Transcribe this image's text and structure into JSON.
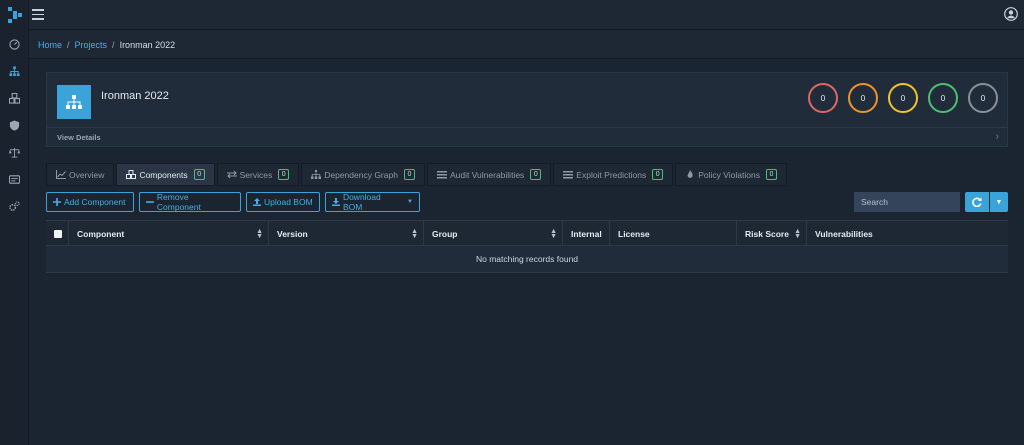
{
  "breadcrumb": {
    "home": "Home",
    "projects": "Projects",
    "current": "Ironman 2022"
  },
  "project": {
    "name": "Ironman 2022",
    "view_details": "View Details",
    "severity_counts": [
      {
        "value": "0",
        "color": "#e06666"
      },
      {
        "value": "0",
        "color": "#f0922b"
      },
      {
        "value": "0",
        "color": "#f2c12e"
      },
      {
        "value": "0",
        "color": "#4cbf74"
      },
      {
        "value": "0",
        "color": "#8a9096"
      }
    ]
  },
  "tabs": [
    {
      "label": "Overview",
      "icon": "chart-line-icon",
      "badge": ""
    },
    {
      "label": "Components",
      "icon": "cubes-icon",
      "badge": "0"
    },
    {
      "label": "Services",
      "icon": "exchange-icon",
      "badge": "0"
    },
    {
      "label": "Dependency Graph",
      "icon": "sitemap-icon",
      "badge": "0"
    },
    {
      "label": "Audit Vulnerabilities",
      "icon": "list-icon",
      "badge": "0"
    },
    {
      "label": "Exploit Predictions",
      "icon": "list-icon",
      "badge": "0"
    },
    {
      "label": "Policy Violations",
      "icon": "fire-icon",
      "badge": "0"
    }
  ],
  "toolbar": {
    "add_component": "Add Component",
    "remove_component": "Remove Component",
    "upload_bom": "Upload BOM",
    "download_bom": "Download BOM",
    "search_placeholder": "Search"
  },
  "table": {
    "columns": [
      "Component",
      "Version",
      "Group",
      "Internal",
      "License",
      "Risk Score",
      "Vulnerabilities"
    ],
    "empty_message": "No matching records found"
  },
  "colors": {
    "accent": "#3aa3da",
    "background": "#1b2431",
    "panel": "#212c3a"
  }
}
